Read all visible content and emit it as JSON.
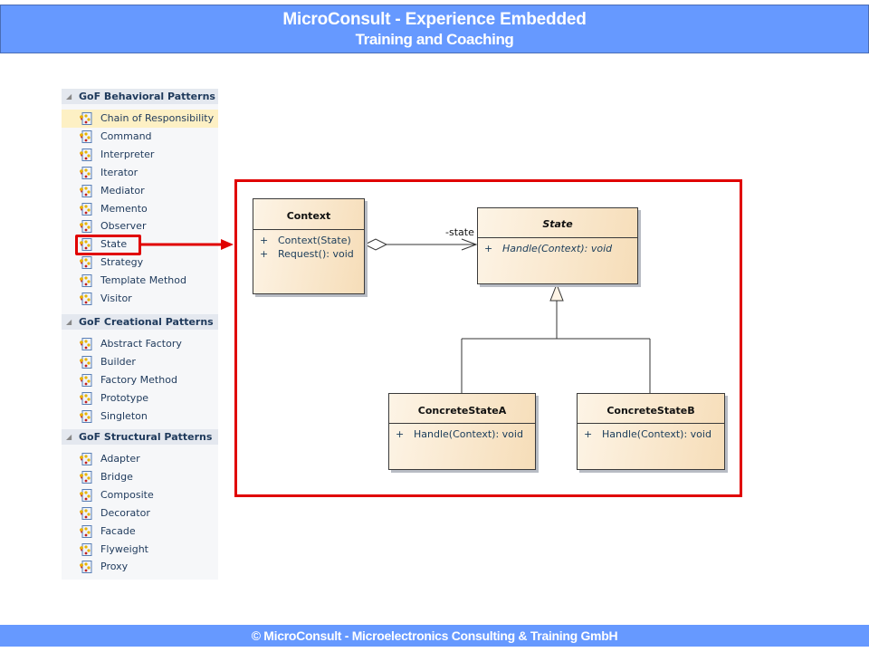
{
  "header": {
    "title": "MicroConsult - Experience Embedded",
    "subtitle": "Training and Coaching"
  },
  "footer": {
    "text": "© MicroConsult - Microelectronics Consulting & Training GmbH"
  },
  "tree": {
    "groups": [
      {
        "label": "GoF Behavioral Patterns",
        "items": [
          "Chain of Responsibility",
          "Command",
          "Interpreter",
          "Iterator",
          "Mediator",
          "Memento",
          "Observer",
          "State",
          "Strategy",
          "Template Method",
          "Visitor"
        ]
      },
      {
        "label": "GoF Creational Patterns",
        "items": [
          "Abstract Factory",
          "Builder",
          "Factory Method",
          "Prototype",
          "Singleton"
        ]
      },
      {
        "label": "GoF Structural Patterns",
        "items": [
          "Adapter",
          "Bridge",
          "Composite",
          "Decorator",
          "Facade",
          "Flyweight",
          "Proxy"
        ]
      }
    ],
    "selected_item": "Chain of Responsibility",
    "highlighted_item": "State"
  },
  "diagram": {
    "classes": {
      "context": {
        "name": "Context",
        "ops": [
          {
            "vis": "+",
            "sig": "Context(State)"
          },
          {
            "vis": "+",
            "sig": "Request(): void"
          }
        ]
      },
      "state": {
        "name": "State",
        "abstract": true,
        "ops": [
          {
            "vis": "+",
            "sig": "Handle(Context): void"
          }
        ]
      },
      "concrete_a": {
        "name": "ConcreteStateA",
        "ops": [
          {
            "vis": "+",
            "sig": "Handle(Context): void"
          }
        ]
      },
      "concrete_b": {
        "name": "ConcreteStateB",
        "ops": [
          {
            "vis": "+",
            "sig": "Handle(Context): void"
          }
        ]
      }
    },
    "association_role": "-state"
  },
  "colors": {
    "banner": "#6699ff",
    "highlight": "#e00000",
    "selection": "#fdf0c4"
  }
}
